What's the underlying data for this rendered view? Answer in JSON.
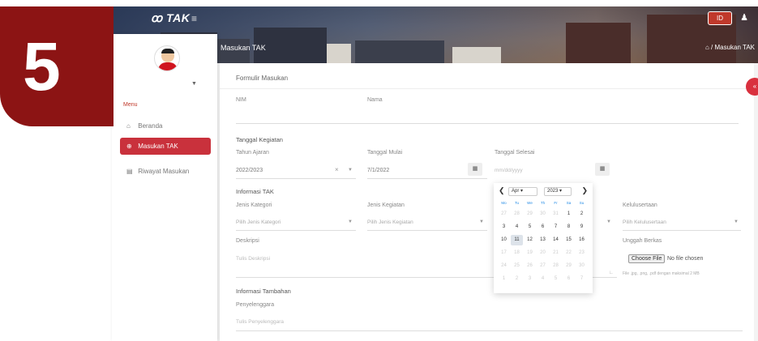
{
  "badge": {
    "number": "5"
  },
  "header": {
    "logo_text": "ꝏ TAK",
    "menu_toggle": "≡",
    "lang_label": "ID",
    "page_title": "Masukan TAK",
    "breadcrumb": "⌂ / Masukan TAK"
  },
  "sidebar": {
    "menu_heading": "Menu",
    "items": [
      {
        "icon": "home-icon",
        "label": "Beranda",
        "active": false
      },
      {
        "icon": "plus-circle-icon",
        "label": "Masukan TAK",
        "active": true
      },
      {
        "icon": "history-icon",
        "label": "Riwayat Masukan",
        "active": false
      }
    ]
  },
  "form": {
    "title": "Formulir Masukan",
    "nim_label": "NIM",
    "nama_label": "Nama",
    "section_kegiatan": "Tanggal Kegiatan",
    "tahun_ajaran_label": "Tahun Ajaran",
    "tahun_ajaran_value": "2022/2023",
    "tanggal_mulai_label": "Tanggal Mulai",
    "tanggal_mulai_value": "7/1/2022",
    "tanggal_selesai_label": "Tanggal Selesai",
    "tanggal_selesai_placeholder": "mm/dd/yyyy",
    "section_informasi": "Informasi TAK",
    "jenis_kategori_label": "Jenis Kategori",
    "jenis_kategori_placeholder": "Pilih Jenis Kategori",
    "jenis_kegiatan_label": "Jenis Kegiatan",
    "jenis_kegiatan_placeholder": "Pilih Jenis Kegiatan",
    "kelulusan_label": "Kelulusertaan",
    "kelulusan_placeholder": "Pilih Kelulusertaan",
    "deskripsi_label": "Deskripsi",
    "deskripsi_placeholder": "Tulis Deskripsi",
    "unggah_label": "Unggah Berkas",
    "file_button": "Choose File",
    "file_none": "No file chosen",
    "file_hint": "File .jpg, .png, .pdf dengan maksimal 2 MB",
    "section_tambahan": "Informasi Tambahan",
    "penyelenggara_label": "Penyelenggara",
    "penyelenggara_placeholder": "Tulis Penyelenggara"
  },
  "datepicker": {
    "month": "Apr",
    "year": "2023",
    "weekdays": [
      "Mo",
      "Tu",
      "We",
      "Th",
      "Fr",
      "Sa",
      "Su"
    ],
    "weeks": [
      [
        "27",
        "28",
        "29",
        "30",
        "31",
        "1",
        "2"
      ],
      [
        "3",
        "4",
        "5",
        "6",
        "7",
        "8",
        "9"
      ],
      [
        "10",
        "11",
        "12",
        "13",
        "14",
        "15",
        "16"
      ],
      [
        "17",
        "18",
        "19",
        "20",
        "21",
        "22",
        "23"
      ],
      [
        "24",
        "25",
        "26",
        "27",
        "28",
        "29",
        "30"
      ],
      [
        "1",
        "2",
        "3",
        "4",
        "5",
        "6",
        "7"
      ]
    ],
    "selected_day": "11"
  }
}
